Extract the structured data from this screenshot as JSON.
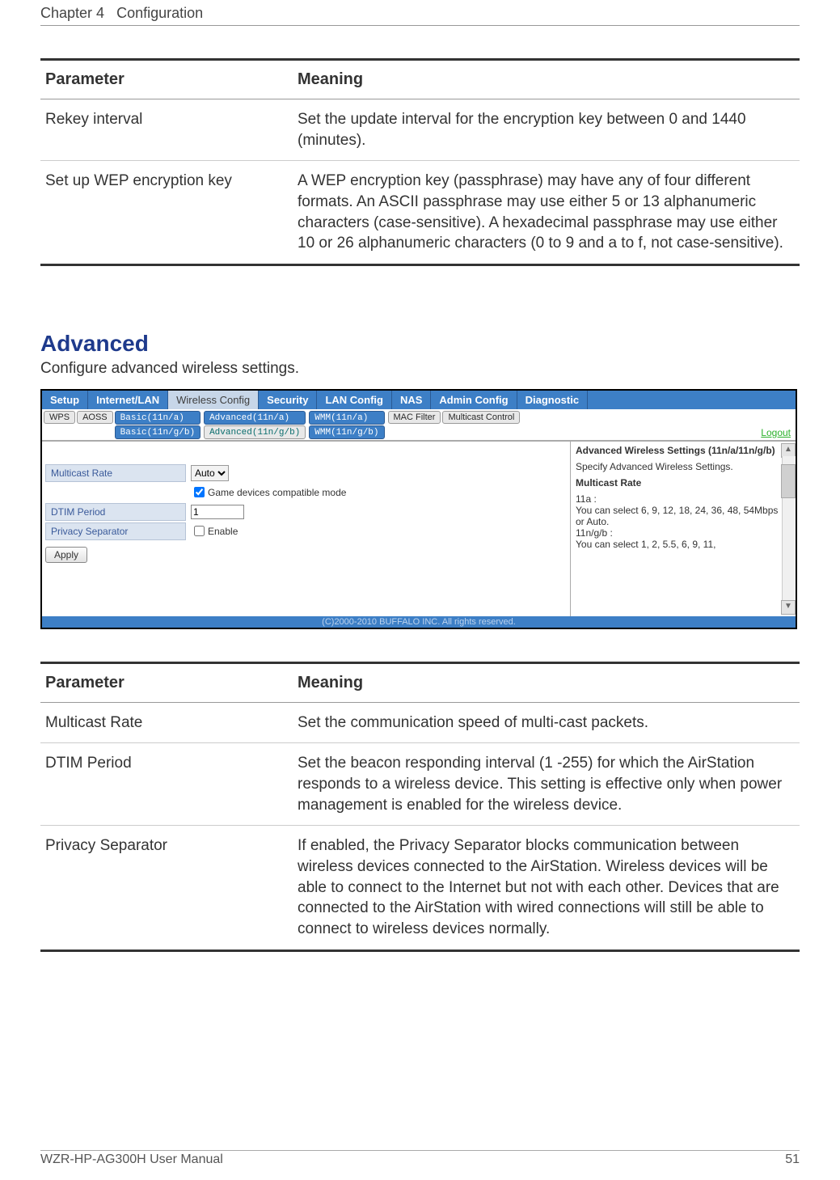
{
  "header": {
    "chapter_label": "Chapter 4",
    "chapter_title": "Configuration"
  },
  "table1": {
    "col_param": "Parameter",
    "col_meaning": "Meaning",
    "rows": [
      {
        "param": "Rekey interval",
        "meaning": "Set the update interval for the encryption key between 0 and 1440 (minutes)."
      },
      {
        "param": "Set up WEP encryption key",
        "meaning": "A WEP encryption key (passphrase) may have any of four different formats.  An ASCII passphrase may use either 5 or 13 alphanumeric characters (case-sensitive).  A hexadecimal passphrase may use either 10 or 26 alphanumeric characters (0 to 9 and a to f, not case-sensitive)."
      }
    ]
  },
  "section": {
    "title": "Advanced",
    "subtitle": "Configure advanced wireless settings."
  },
  "ui": {
    "main_tabs": {
      "setup": "Setup",
      "internet_lan": "Internet/LAN",
      "wireless_config": "Wireless Config",
      "security": "Security",
      "lan_config": "LAN Config",
      "nas": "NAS",
      "admin_config": "Admin Config",
      "diagnostic": "Diagnostic"
    },
    "sub_tabs": {
      "wps": "WPS",
      "aoss": "AOSS",
      "basic_a": "Basic(11n/a)",
      "basic_gb": "Basic(11n/g/b)",
      "advanced_a": "Advanced(11n/a)",
      "advanced_gb": "Advanced(11n/g/b)",
      "wmm_a": "WMM(11n/a)",
      "wmm_gb": "WMM(11n/g/b)",
      "mac_filter": "MAC Filter",
      "multicast_ctrl": "Multicast Control"
    },
    "logout": "Logout",
    "form": {
      "multicast_label": "Multicast Rate",
      "multicast_value": "Auto",
      "game_mode_label": "Game devices compatible mode",
      "dtim_label": "DTIM Period",
      "dtim_value": "1",
      "privacy_label": "Privacy Separator",
      "enable_label": "Enable",
      "apply": "Apply"
    },
    "help": {
      "title": "Advanced Wireless Settings (11n/a/11n/g/b)",
      "p1": "Specify Advanced Wireless Settings.",
      "h2": "Multicast Rate",
      "p2a": "11a :",
      "p2b": "You can select 6, 9, 12, 18, 24, 36, 48, 54Mbps or Auto.",
      "p2c": "11n/g/b :",
      "p2d": "You can select 1, 2, 5.5, 6, 9, 11,"
    },
    "footer_copy": "(C)2000-2010 BUFFALO INC. All rights reserved."
  },
  "table2": {
    "col_param": "Parameter",
    "col_meaning": "Meaning",
    "rows": [
      {
        "param": "Multicast Rate",
        "meaning": "Set the communication speed of multi-cast packets."
      },
      {
        "param": "DTIM Period",
        "meaning": "Set the beacon responding interval (1 -255) for which the AirStation responds to a wireless device. This setting is effective only when power management is enabled for the wireless device."
      },
      {
        "param": "Privacy Separator",
        "meaning": "If enabled, the Privacy Separator blocks communication between wireless devices connected to the AirStation. Wireless devices will be able to connect to the Internet but not with each other. Devices that are connected to the AirStation with wired connections will still be able to connect to wireless devices normally."
      }
    ]
  },
  "footer": {
    "manual": "WZR-HP-AG300H User Manual",
    "page_no": "51"
  }
}
